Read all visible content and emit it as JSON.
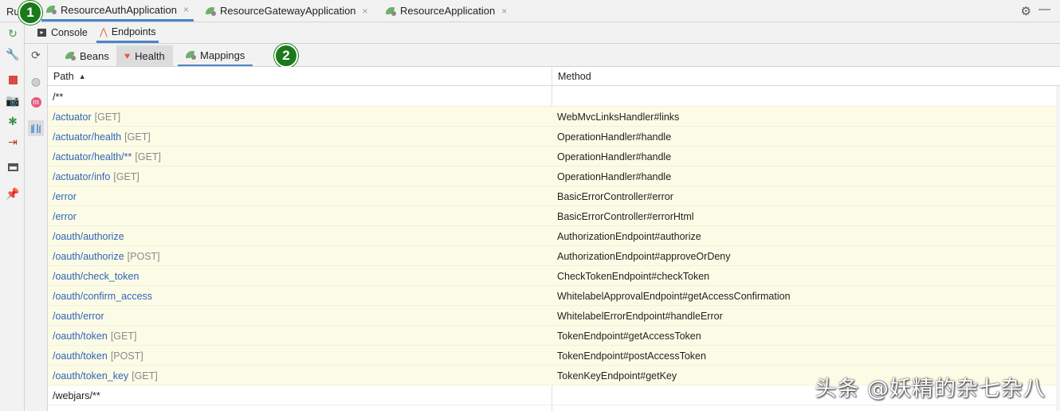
{
  "run_bar": {
    "label": "Ru",
    "tabs": [
      {
        "label": "ResourceAuthApplication",
        "active": true
      },
      {
        "label": "ResourceGatewayApplication",
        "active": false
      },
      {
        "label": "ResourceApplication",
        "active": false
      }
    ],
    "close_glyph": "×"
  },
  "badges": {
    "one": "1",
    "two": "2"
  },
  "tool_tabs": {
    "console": "Console",
    "endpoints": "Endpoints"
  },
  "endpoint_tabs": {
    "beans": "Beans",
    "health": "Health",
    "mappings": "Mappings"
  },
  "table": {
    "headers": {
      "path": "Path",
      "method": "Method",
      "sort_glyph": "▲"
    },
    "rows": [
      {
        "path": "/**",
        "verb": "",
        "method": "",
        "link": false,
        "hl": false
      },
      {
        "path": "/actuator",
        "verb": "[GET]",
        "method": "WebMvcLinksHandler#links",
        "link": true,
        "hl": true
      },
      {
        "path": "/actuator/health",
        "verb": "[GET]",
        "method": "OperationHandler#handle",
        "link": true,
        "hl": true
      },
      {
        "path": "/actuator/health/**",
        "verb": "[GET]",
        "method": "OperationHandler#handle",
        "link": true,
        "hl": true
      },
      {
        "path": "/actuator/info",
        "verb": "[GET]",
        "method": "OperationHandler#handle",
        "link": true,
        "hl": true
      },
      {
        "path": "/error",
        "verb": "",
        "method": "BasicErrorController#error",
        "link": true,
        "hl": true
      },
      {
        "path": "/error",
        "verb": "",
        "method": "BasicErrorController#errorHtml",
        "link": true,
        "hl": true
      },
      {
        "path": "/oauth/authorize",
        "verb": "",
        "method": "AuthorizationEndpoint#authorize",
        "link": true,
        "hl": true
      },
      {
        "path": "/oauth/authorize",
        "verb": "[POST]",
        "method": "AuthorizationEndpoint#approveOrDeny",
        "link": true,
        "hl": true
      },
      {
        "path": "/oauth/check_token",
        "verb": "",
        "method": "CheckTokenEndpoint#checkToken",
        "link": true,
        "hl": true
      },
      {
        "path": "/oauth/confirm_access",
        "verb": "",
        "method": "WhitelabelApprovalEndpoint#getAccessConfirmation",
        "link": true,
        "hl": true
      },
      {
        "path": "/oauth/error",
        "verb": "",
        "method": "WhitelabelErrorEndpoint#handleError",
        "link": true,
        "hl": true
      },
      {
        "path": "/oauth/token",
        "verb": "[GET]",
        "method": "TokenEndpoint#getAccessToken",
        "link": true,
        "hl": true
      },
      {
        "path": "/oauth/token",
        "verb": "[POST]",
        "method": "TokenEndpoint#postAccessToken",
        "link": true,
        "hl": true
      },
      {
        "path": "/oauth/token_key",
        "verb": "[GET]",
        "method": "TokenKeyEndpoint#getKey",
        "link": true,
        "hl": true
      },
      {
        "path": "/webjars/**",
        "verb": "",
        "method": "",
        "link": false,
        "hl": false
      }
    ]
  },
  "watermark": "头条 @妖精的杂七杂八",
  "colors": {
    "accent": "#4a86c8",
    "link": "#2f63b8",
    "row_highlight": "#fcfce6",
    "badge": "#1a7a1a"
  }
}
